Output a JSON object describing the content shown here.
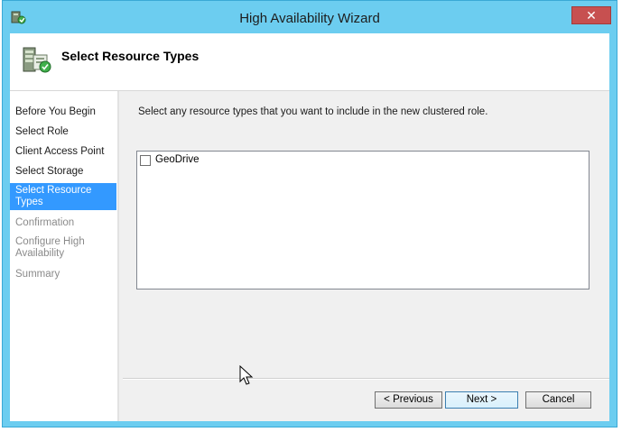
{
  "window": {
    "title": "High Availability Wizard",
    "close_label": "✕"
  },
  "header": {
    "title": "Select Resource Types"
  },
  "sidebar": {
    "steps": [
      {
        "label": "Before You Begin",
        "state": "done"
      },
      {
        "label": "Select Role",
        "state": "done"
      },
      {
        "label": "Client Access Point",
        "state": "done"
      },
      {
        "label": "Select Storage",
        "state": "done"
      },
      {
        "label": "Select Resource Types",
        "state": "active"
      },
      {
        "label": "Confirmation",
        "state": "disabled"
      },
      {
        "label": "Configure High Availability",
        "state": "disabled"
      },
      {
        "label": "Summary",
        "state": "disabled"
      }
    ]
  },
  "main": {
    "instruction": "Select any resource types that you want to include in the new clustered role.",
    "resource_types": [
      {
        "label": "GeoDrive",
        "checked": false
      }
    ]
  },
  "buttons": {
    "previous": "< Previous",
    "next": "Next >",
    "cancel": "Cancel"
  }
}
